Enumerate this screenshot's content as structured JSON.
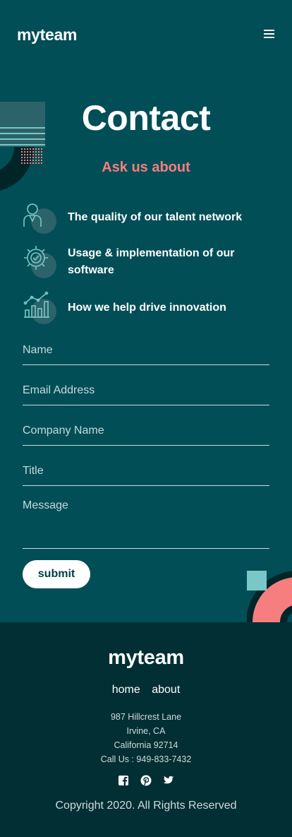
{
  "header": {
    "logo": "myteam",
    "menu_icon": "hamburger-icon"
  },
  "contact": {
    "title": "Contact",
    "subtitle": "Ask us about",
    "topics": [
      {
        "icon": "person-icon",
        "text": "The quality of our talent network"
      },
      {
        "icon": "gear-check-icon",
        "text": "Usage & implementation of our software"
      },
      {
        "icon": "growth-chart-icon",
        "text": "How we help drive innovation"
      }
    ]
  },
  "form": {
    "name_placeholder": "Name",
    "email_placeholder": "Email Address",
    "company_placeholder": "Company Name",
    "title_placeholder": "Title",
    "message_placeholder": "Message",
    "submit_label": "submit"
  },
  "footer": {
    "logo": "myteam",
    "nav": [
      "home",
      "about"
    ],
    "address": [
      "987 Hillcrest Lane",
      "Irvine, CA",
      "California 92714",
      "Call Us : 949-833-7432"
    ],
    "social": [
      "facebook-icon",
      "pinterest-icon",
      "twitter-icon"
    ],
    "copyright": "Copyright 2020. All Rights Reserved"
  },
  "colors": {
    "background": "#014e56",
    "footer": "#012f34",
    "accent": "#f67e7e",
    "light_teal": "#79c8c7",
    "button_text": "#004047"
  }
}
